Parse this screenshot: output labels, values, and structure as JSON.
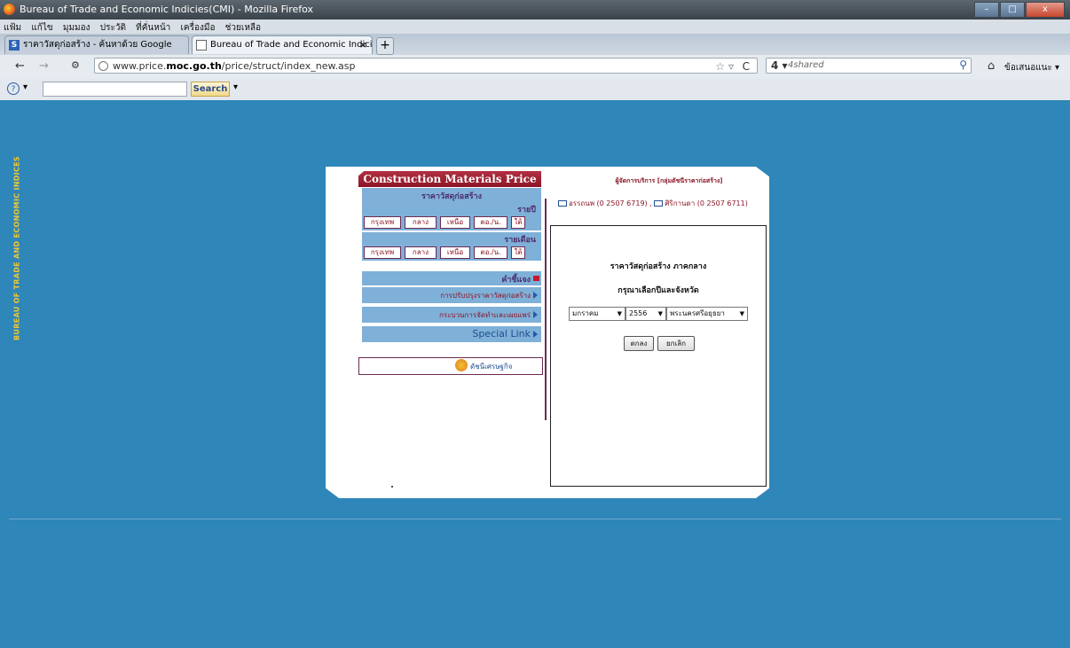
{
  "window": {
    "title": "Bureau of Trade and Economic Indicies(CMI) - Mozilla Firefox",
    "buttons": {
      "minimize": "–",
      "maximize": "□",
      "close": "x"
    }
  },
  "menu": [
    "แฟ้ม",
    "แก้ไข",
    "มุมมอง",
    "ประวัติ",
    "ที่คั่นหน้า",
    "เครื่องมือ",
    "ช่วยเหลือ"
  ],
  "tabs": [
    {
      "label": "ราคาวัสดุก่อสร้าง - ค้นหาด้วย Google",
      "favicon": "S",
      "active": false
    },
    {
      "label": "Bureau of Trade and Economic Indici...",
      "favicon": "",
      "active": true
    }
  ],
  "tab_close": "×",
  "new_tab": "+",
  "nav": {
    "back": "←",
    "forward": "→",
    "url_prefix": "www.price.",
    "url_domain": "moc.go.th",
    "url_path": "/price/struct/index_new.asp",
    "star": "☆ ▿",
    "reload": "C",
    "search_engine": "4 ▾",
    "search_placeholder": "4shared",
    "search_icon": "⚲",
    "home": "⌂",
    "suggest": "ข้อเสนอแนะ ▾"
  },
  "toolbar": {
    "logo": "?",
    "caret": "▾",
    "search_button": "Search",
    "search_caret": "▾"
  },
  "side_text": "BUREAU OF TRADE AND ECONOMIC INDICES",
  "site": {
    "header": "Construction Materials Price",
    "section_title": "ราคาวัสดุก่อสร้าง",
    "yearly_label": "รายปี",
    "monthly_label": "รายเดือน",
    "regions": [
      "กรุงเทพ",
      "กลาง",
      "เหนือ",
      "ตอ./น.",
      "ใต้"
    ],
    "definition_label": "คำชี้แจง",
    "link_adjust": "การปรับปรุงราคาวัสดุก่อสร้าง",
    "link_process": "กระบวนการจัดทำและเผยแพร่",
    "link_special": "Special Link",
    "promo": "ดัชนีเศรษฐกิจ",
    "provider": "ผู้จัดการบริการ [กลุ่มดัชนีราคาก่อสร้าง]",
    "contact1": "อรรถนพ (0 2507 6719)",
    "contact_sep": ",",
    "contact2": "ศิริกานดา (0 2507 6711)",
    "form_title": "ราคาวัสดุก่อสร้าง ภาคกลาง",
    "form_subtitle": "กรุณาเลือกปีและจังหวัด",
    "month": "มกราคม",
    "year": "2556",
    "province": "พระนครศรีอยุธยา",
    "ok": "ตกลง",
    "cancel": "ยกเลิก"
  }
}
